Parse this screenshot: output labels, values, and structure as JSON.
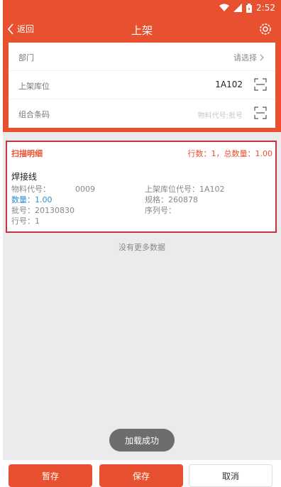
{
  "status_bar": {
    "time": "2:52",
    "icons": [
      "wifi-icon",
      "signal-icon",
      "battery-icon"
    ]
  },
  "app_bar": {
    "back_label": "返回",
    "title": "上架",
    "settings_icon": "gear-icon"
  },
  "form": {
    "department_label": "部门",
    "department_select": "请选择",
    "location_label": "上架库位",
    "location_value": "1A102",
    "barcode_label": "组合条码",
    "barcode_placeholder": "物料代号;批号"
  },
  "detail": {
    "title": "扫描明细",
    "summary": "行数：1，总数量：1.00",
    "item_name": "焊接线",
    "material_code": "物料代号：",
    "material_code_value": "0009",
    "location_code": "上架库位代号：1A102",
    "quantity": "数量：1.00",
    "spec": "规格：260878",
    "batch": "批号：20130830",
    "serial": "序列号：",
    "line": "行号：1"
  },
  "list_footer": "没有更多数据",
  "toast": "加载成功",
  "buttons": {
    "save_draft": "暂存",
    "save": "保存",
    "cancel": "取消"
  },
  "colors": {
    "accent": "#e8512f",
    "highlight_border": "#c8323f",
    "quantity_blue": "#2f8fcf"
  }
}
